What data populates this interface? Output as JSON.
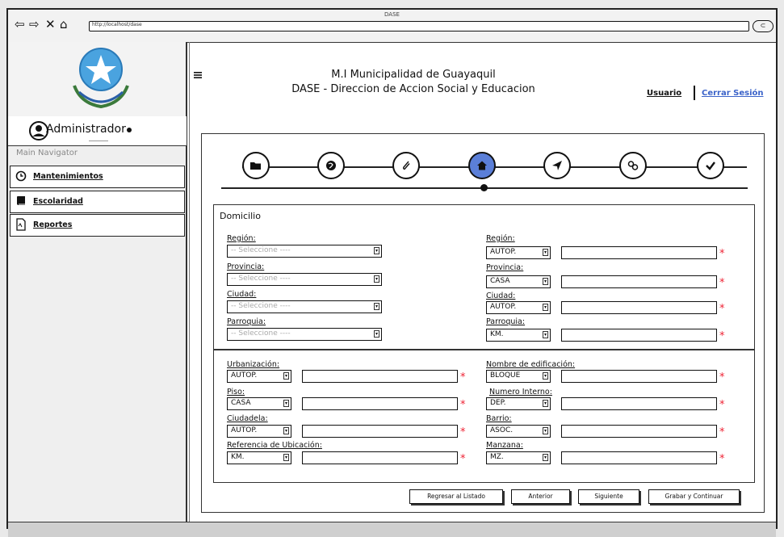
{
  "window": {
    "title": "DASE",
    "url": "http://localhost/dase"
  },
  "header": {
    "line1": "M.I Municipalidad de Guayaquil",
    "line2": "DASE - Direccion de Accion Social y Educacion",
    "user_link": "Usuario",
    "logout_link": "Cerrar Sesión"
  },
  "sidebar": {
    "username": "Administrador",
    "nav_title": "Main Navigator",
    "items": [
      {
        "label": "Mantenimientos",
        "icon": "clock-icon"
      },
      {
        "label": "Escolaridad",
        "icon": "book-icon"
      },
      {
        "label": "Reportes",
        "icon": "document-icon"
      }
    ]
  },
  "steps": [
    {
      "icon": "folder-icon",
      "active": false
    },
    {
      "icon": "globe-icon",
      "active": false
    },
    {
      "icon": "paperclip-icon",
      "active": false
    },
    {
      "icon": "home-icon",
      "active": true
    },
    {
      "icon": "send-icon",
      "active": false
    },
    {
      "icon": "link-icon",
      "active": false
    },
    {
      "icon": "check-icon",
      "active": false
    }
  ],
  "form": {
    "title": "Domicilio",
    "left_top": [
      {
        "label": "Región:",
        "value": "-- Seleccione ----"
      },
      {
        "label": "Provincia:",
        "value": "-- Seleccione ----"
      },
      {
        "label": "Ciudad:",
        "value": "-- Seleccione ----"
      },
      {
        "label": "Parroquia:",
        "value": "-- Seleccione ----"
      }
    ],
    "right_top": [
      {
        "label": "Región:",
        "value": "AUTOP."
      },
      {
        "label": "Provincia:",
        "value": "CASA"
      },
      {
        "label": "Ciudad:",
        "value": "AUTOP."
      },
      {
        "label": "Parroquia:",
        "value": "KM."
      }
    ],
    "left_bottom": [
      {
        "label": "Urbanización:",
        "value": "AUTOP."
      },
      {
        "label": "Piso:",
        "value": "CASA"
      },
      {
        "label": "Ciudadela:",
        "value": "AUTOP."
      },
      {
        "label": "Referencia de Ubicación:",
        "value": "KM."
      }
    ],
    "right_bottom": [
      {
        "label": "Nombre de edificación:",
        "value": "BLOQUE"
      },
      {
        "label": "Numero Interno:",
        "value": "DEP."
      },
      {
        "label": "Barrio:",
        "value": "ASOC."
      },
      {
        "label": "Manzana:",
        "value": "MZ."
      }
    ],
    "required_mark": "*"
  },
  "buttons": {
    "back_list": "Regresar al Listado",
    "prev": "Anterior",
    "next": "Siguiente",
    "save_continue": "Grabar y Continuar"
  },
  "colors": {
    "active_step": "#5b7fd8",
    "required": "#e23333",
    "logout_link": "#3b63c9"
  }
}
